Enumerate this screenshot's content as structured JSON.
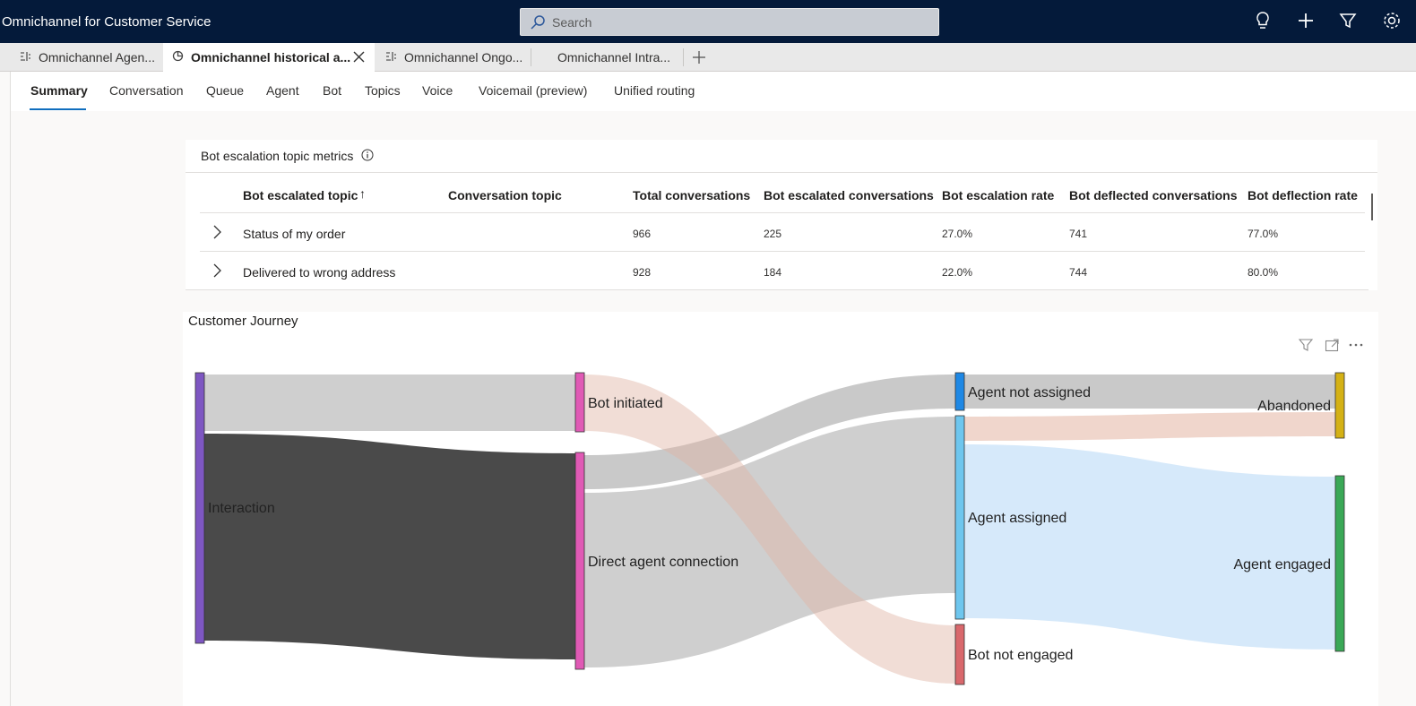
{
  "app": {
    "title": "Omnichannel for Customer Service"
  },
  "search": {
    "placeholder": "Search"
  },
  "header_icons": [
    "lightbulb-icon",
    "plus-icon",
    "filter-icon",
    "settings-icon"
  ],
  "tabs": [
    {
      "label": "Omnichannel Agen...",
      "icon": "dashboard-icon",
      "active": false
    },
    {
      "label": "Omnichannel historical a...",
      "icon": "report-icon",
      "active": true
    },
    {
      "label": "Omnichannel Ongo...",
      "icon": "dashboard-icon",
      "active": false
    },
    {
      "label": "Omnichannel Intra...",
      "icon": "",
      "active": false
    }
  ],
  "subnav": [
    "Summary",
    "Conversation",
    "Queue",
    "Agent",
    "Bot",
    "Topics",
    "Voice",
    "Voicemail (preview)",
    "Unified routing"
  ],
  "bot_table": {
    "title": "Bot escalation topic metrics",
    "sort_indicator": "↑",
    "columns": [
      "Bot escalated topic",
      "Conversation topic",
      "Total conversations",
      "Bot escalated conversations",
      "Bot escalation rate",
      "Bot deflected conversations",
      "Bot deflection rate"
    ],
    "rows": [
      {
        "topic": "Status of my order",
        "conversation_topic": "",
        "total": "966",
        "escalated": "225",
        "escalation_rate": "27.0%",
        "deflected": "741",
        "deflection_rate": "77.0%"
      },
      {
        "topic": "Delivered to wrong address",
        "conversation_topic": "",
        "total": "928",
        "escalated": "184",
        "escalation_rate": "22.0%",
        "deflected": "744",
        "deflection_rate": "80.0%"
      }
    ]
  },
  "journey": {
    "title": "Customer Journey",
    "toolbar": [
      "filter-icon",
      "expand-icon",
      "more-icon"
    ],
    "nodes": {
      "interaction": "Interaction",
      "bot_initiated": "Bot initiated",
      "direct_agent": "Direct agent connection",
      "agent_not_assigned": "Agent not assigned",
      "agent_assigned": "Agent assigned",
      "bot_not_engaged": "Bot not engaged",
      "abandoned": "Abandoned",
      "agent_engaged": "Agent engaged"
    },
    "colors": {
      "interaction": "#7e57c2",
      "bot_initiated": "#e05ab5",
      "direct_agent": "#e05ab5",
      "agent_not_assigned": "#1e88e5",
      "agent_assigned": "#6ec6ee",
      "bot_not_engaged": "#d9686c",
      "abandoned": "#d4b115",
      "agent_engaged": "#3aa856"
    }
  }
}
